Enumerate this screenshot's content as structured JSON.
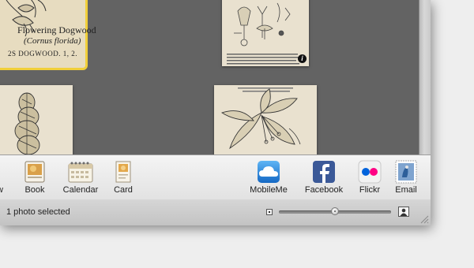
{
  "browser": {
    "selected_photo": {
      "title_line": "Flowering Dogwood",
      "latin_name": "(Cornus florida)",
      "plate_caption": "2S DOGWOOD. 1, 2."
    },
    "thumbnails": [
      {
        "kind": "plant-anatomy-plate",
        "has_info_badge": true
      },
      {
        "kind": "lupine-engraving"
      },
      {
        "kind": "lily-engraving"
      }
    ],
    "info_badge_glyph": "i"
  },
  "toolbar": {
    "left_items": [
      {
        "id": "slideshow",
        "label": "w",
        "icon": "slideshow-icon"
      },
      {
        "id": "book",
        "label": "Book",
        "icon": "book-icon"
      },
      {
        "id": "calendar",
        "label": "Calendar",
        "icon": "calendar-icon"
      },
      {
        "id": "card",
        "label": "Card",
        "icon": "card-icon"
      }
    ],
    "right_items": [
      {
        "id": "mobileme",
        "label": "MobileMe",
        "icon": "cloud-icon",
        "color": "#1c7fd6"
      },
      {
        "id": "facebook",
        "label": "Facebook",
        "icon": "facebook-icon",
        "color": "#3b5998"
      },
      {
        "id": "flickr",
        "label": "Flickr",
        "icon": "flickr-icon",
        "colors": [
          "#0063dc",
          "#ff0084"
        ]
      },
      {
        "id": "email",
        "label": "Email",
        "icon": "stamp-icon",
        "color": "#2d5f9a"
      }
    ]
  },
  "status": {
    "selection_text": "1 photo selected",
    "zoom_fraction": 0.5
  },
  "colors": {
    "selection_border": "#f1cf3a",
    "grid_background": "#636363"
  }
}
